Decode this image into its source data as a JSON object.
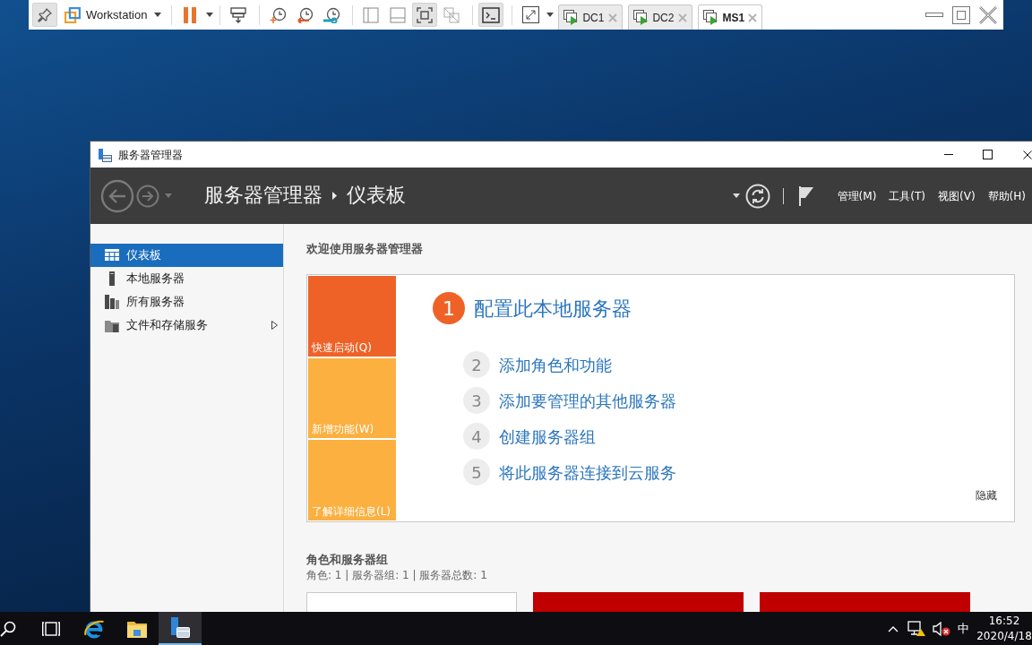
{
  "vm_toolbar": {
    "pin": {
      "pressed": true
    },
    "product": "Workstation",
    "groups": [
      {
        "items": [
          {
            "kind": "pause",
            "pressed": false,
            "dropdown": true
          }
        ]
      },
      {
        "items": [
          {
            "kind": "send-keys",
            "pressed": false,
            "dropdown": false
          }
        ]
      },
      {
        "items": [
          {
            "kind": "snapshot-take",
            "pressed": false,
            "dropdown": false
          },
          {
            "kind": "snapshot-revert",
            "pressed": false,
            "dropdown": false
          },
          {
            "kind": "snapshot-manager",
            "pressed": false,
            "dropdown": false
          }
        ]
      },
      {
        "items": [
          {
            "kind": "library",
            "pressed": false,
            "dropdown": false
          },
          {
            "kind": "thumbnail",
            "pressed": false,
            "dropdown": false
          },
          {
            "kind": "fit-guest",
            "pressed": true,
            "dropdown": false
          },
          {
            "kind": "unity",
            "pressed": false,
            "dropdown": false
          }
        ]
      },
      {
        "items": [
          {
            "kind": "console",
            "pressed": true,
            "dropdown": false
          }
        ]
      },
      {
        "items": [
          {
            "kind": "fullscreen",
            "pressed": false,
            "dropdown": true
          }
        ]
      }
    ],
    "tabs": [
      {
        "label": "DC1",
        "selected": false
      },
      {
        "label": "DC2",
        "selected": false
      },
      {
        "label": "MS1",
        "selected": true
      }
    ]
  },
  "server_manager": {
    "title": "服务器管理器",
    "breadcrumb": {
      "root": "服务器管理器",
      "page": "仪表板"
    },
    "menus": [
      "管理(M)",
      "工具(T)",
      "视图(V)",
      "帮助(H)"
    ],
    "sidebar": [
      {
        "label": "仪表板",
        "kind": "dashboard",
        "selected": true,
        "expandable": false
      },
      {
        "label": "本地服务器",
        "kind": "local-server",
        "selected": false,
        "expandable": false
      },
      {
        "label": "所有服务器",
        "kind": "all-servers",
        "selected": false,
        "expandable": false
      },
      {
        "label": "文件和存储服务",
        "kind": "file-storage",
        "selected": false,
        "expandable": true
      }
    ],
    "welcome": {
      "heading": "欢迎使用服务器管理器",
      "tiles": [
        {
          "label": "快速启动(Q)",
          "selected": true
        },
        {
          "label": "新增功能(W)",
          "selected": false
        },
        {
          "label": "了解详细信息(L)",
          "selected": false
        }
      ],
      "steps": [
        {
          "number": "1",
          "label": "配置此本地服务器",
          "selected": true
        },
        {
          "number": "2",
          "label": "添加角色和功能",
          "selected": false
        },
        {
          "number": "3",
          "label": "添加要管理的其他服务器",
          "selected": false
        },
        {
          "number": "4",
          "label": "创建服务器组",
          "selected": false
        },
        {
          "number": "5",
          "label": "将此服务器连接到云服务",
          "selected": false
        }
      ],
      "hide": "隐藏"
    },
    "roles": {
      "heading": "角色和服务器组",
      "summary": "角色: 1 | 服务器组: 1 | 服务器总数: 1",
      "tiles": [
        {
          "alert": false
        },
        {
          "alert": true
        },
        {
          "alert": true
        }
      ]
    }
  },
  "taskbar": {
    "apps": [
      {
        "kind": "browser",
        "active": false
      },
      {
        "kind": "explorer",
        "active": false
      },
      {
        "kind": "server-manager",
        "active": true
      }
    ],
    "tray": {
      "ime": "中",
      "time": "16:52",
      "date": "2020/4/18"
    }
  }
}
